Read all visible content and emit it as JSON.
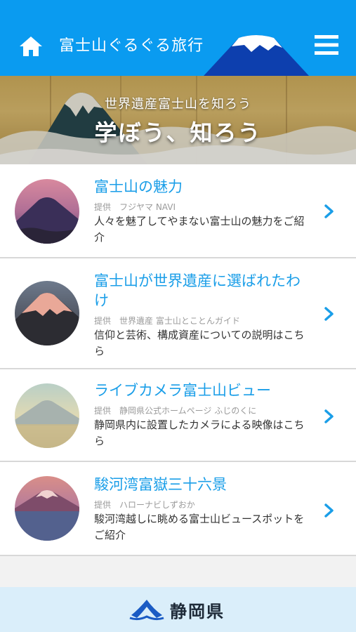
{
  "header": {
    "title": "富士山ぐるぐる旅行",
    "icons": [
      "home-icon",
      "mount-fuji-icon",
      "hamburger-menu-icon"
    ],
    "color": "#0a9bf0"
  },
  "banner": {
    "subtitle": "世界遺産富士山を知ろう",
    "heading": "学ぼう、知ろう"
  },
  "items": [
    {
      "title": "富士山の魅力",
      "provider": "提供　フジヤマ NAVI",
      "description": "人々を魅了してやまない富士山の魅力をご紹介"
    },
    {
      "title": "富士山が世界遺産に選ばれたわけ",
      "provider": "提供　世界遺産 富士山とことんガイド",
      "description": "信仰と芸術、構成資産についての説明はこちら"
    },
    {
      "title": "ライブカメラ富士山ビュー",
      "provider": "提供　静岡県公式ホームページ ふじのくに",
      "description": "静岡県内に設置したカメラによる映像はこちら"
    },
    {
      "title": "駿河湾富嶽三十六景",
      "provider": "提供　ハローナビしずおか",
      "description": "駿河湾越しに眺める富士山ビュースポットをご紹介"
    }
  ],
  "footer": {
    "prefecture": "静岡県"
  },
  "colors": {
    "accent": "#1a9ee8",
    "footer_bg": "#daeefa"
  }
}
